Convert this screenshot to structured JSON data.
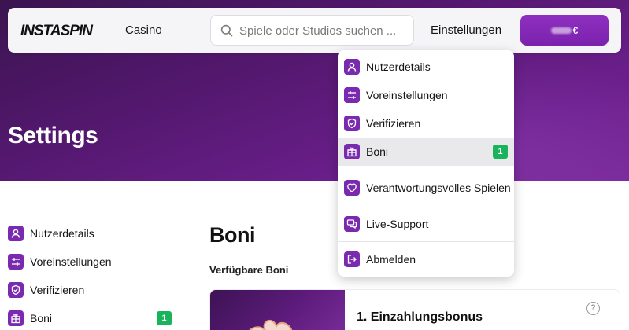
{
  "header": {
    "logo": "INSTASPIN",
    "nav_casino": "Casino",
    "search_placeholder": "Spiele oder Studios suchen ...",
    "nav_settings": "Einstellungen",
    "balance_currency": "€"
  },
  "hero": {
    "title": "Settings"
  },
  "dropdown": {
    "items": [
      {
        "label": "Nutzerdetails",
        "icon": "user-icon"
      },
      {
        "label": "Voreinstellungen",
        "icon": "sliders-icon"
      },
      {
        "label": "Verifizieren",
        "icon": "shield-check-icon"
      },
      {
        "label": "Boni",
        "icon": "gift-icon",
        "badge": "1",
        "active": true
      },
      {
        "label": "Verantwortungsvolles Spielen",
        "icon": "heart-icon"
      },
      {
        "label": "Live-Support",
        "icon": "chat-icon"
      },
      {
        "label": "Abmelden",
        "icon": "logout-icon"
      }
    ]
  },
  "sidebar": {
    "items": [
      {
        "label": "Nutzerdetails",
        "icon": "user-icon"
      },
      {
        "label": "Voreinstellungen",
        "icon": "sliders-icon"
      },
      {
        "label": "Verifizieren",
        "icon": "shield-check-icon"
      },
      {
        "label": "Boni",
        "icon": "gift-icon",
        "badge": "1"
      }
    ]
  },
  "main": {
    "title": "Boni",
    "subtitle": "Verfügbare Boni",
    "bonus_card": {
      "title": "1. Einzahlungsbonus",
      "help": "?"
    }
  },
  "colors": {
    "accent": "#7a2aaf",
    "badge_green": "#18b35b",
    "hero_purple": "#54186f",
    "button_purple": "#8f2fc0"
  }
}
